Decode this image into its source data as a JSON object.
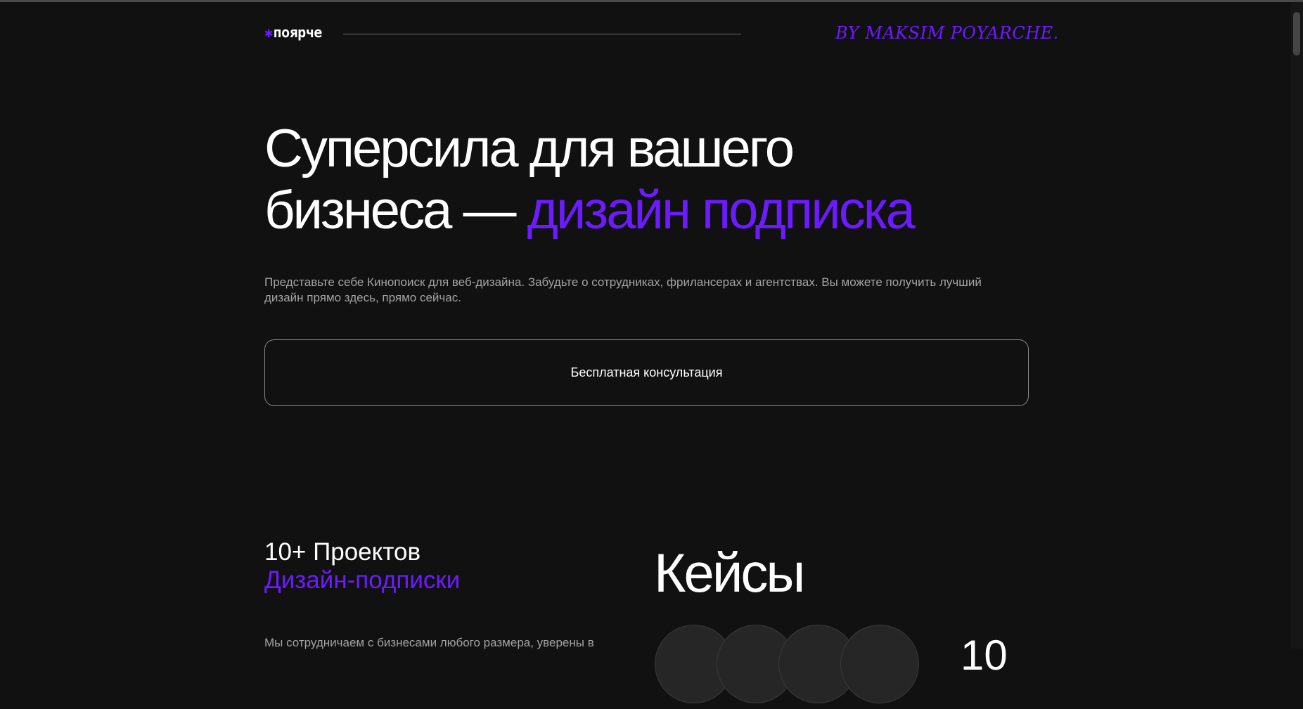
{
  "header": {
    "logo_mark": "✱",
    "logo_text": "поярче",
    "byline": "BY MAKSIM POYARCHE."
  },
  "hero": {
    "title_line1": "Суперсила для вашего",
    "title_line2_prefix": "бизнеса — ",
    "title_line2_accent": "дизайн подписка",
    "description": "Представьте себе Кинопоиск для веб-дизайна. Забудьте о сотрудниках, фрилансерах и агентствах. Вы можете получить лучший дизайн прямо здесь, прямо сейчас.",
    "cta_label": "Бесплатная консультация"
  },
  "stats": {
    "count": "10+ Проектов",
    "label": "Дизайн-подписки",
    "description": "Мы сотрудничаем с бизнесами любого размера, уверены в"
  },
  "cases": {
    "title": "Кейсы",
    "count": "10"
  },
  "colors": {
    "background": "#111111",
    "accent": "#6c1bff",
    "text": "#ffffff",
    "muted": "#a3a3a3"
  }
}
